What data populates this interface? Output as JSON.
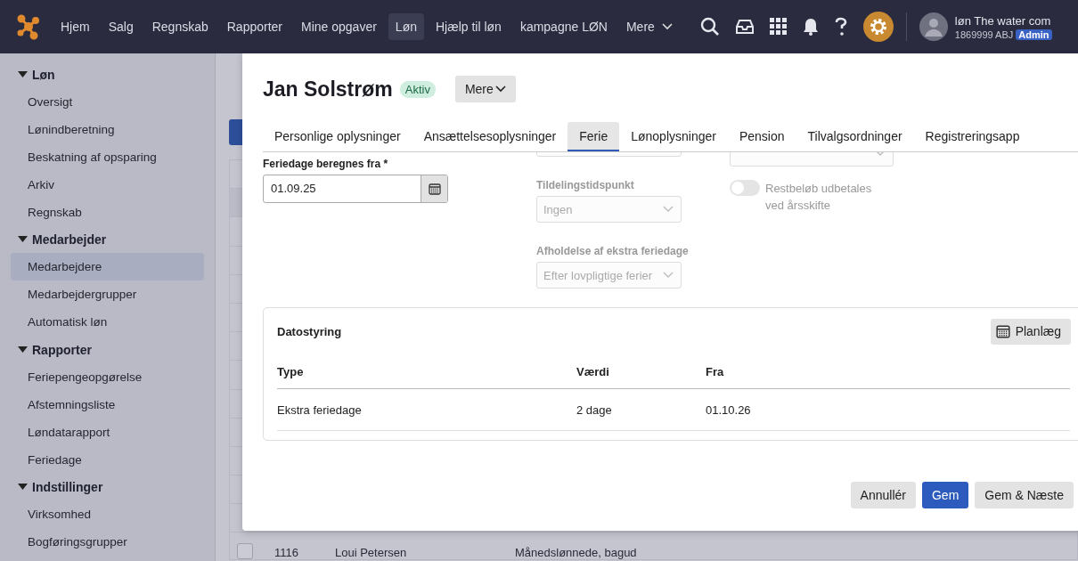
{
  "topbar": {
    "nav": [
      {
        "label": "Hjem",
        "selected": false
      },
      {
        "label": "Salg",
        "selected": false
      },
      {
        "label": "Regnskab",
        "selected": false
      },
      {
        "label": "Rapporter",
        "selected": false
      },
      {
        "label": "Mine opgaver",
        "selected": false
      },
      {
        "label": "Løn",
        "selected": true
      },
      {
        "label": "Hjælp til løn",
        "selected": false
      },
      {
        "label": "kampagne LØN",
        "selected": false
      }
    ],
    "more": "Mere",
    "user": {
      "name": "løn The water com",
      "account": "1869999 ABJ",
      "role": "Admin"
    }
  },
  "sidebar": {
    "groups": [
      {
        "title": "Løn",
        "expanded": true,
        "items": [
          {
            "label": "Oversigt",
            "selected": false
          },
          {
            "label": "Lønindberetning",
            "selected": false
          },
          {
            "label": "Beskatning af opsparing",
            "selected": false
          },
          {
            "label": "Arkiv",
            "selected": false
          },
          {
            "label": "Regnskab",
            "selected": false
          }
        ]
      },
      {
        "title": "Medarbejder",
        "expanded": true,
        "items": [
          {
            "label": "Medarbejdere",
            "selected": true
          },
          {
            "label": "Medarbejdergrupper",
            "selected": false
          },
          {
            "label": "Automatisk løn",
            "selected": false
          }
        ]
      },
      {
        "title": "Rapporter",
        "expanded": true,
        "items": [
          {
            "label": "Feriepengeopgørelse",
            "selected": false
          },
          {
            "label": "Afstemningsliste",
            "selected": false
          },
          {
            "label": "Løndatarapport",
            "selected": false
          },
          {
            "label": "Feriedage",
            "selected": false
          }
        ]
      },
      {
        "title": "Indstillinger",
        "expanded": true,
        "items": [
          {
            "label": "Virksomhed",
            "selected": false
          },
          {
            "label": "Bogføringsgrupper",
            "selected": false
          }
        ]
      }
    ]
  },
  "page": {
    "last_row": {
      "checked": false,
      "cells": [
        "1116",
        "Loui Petersen",
        "Månedslønnede, bagud"
      ]
    }
  },
  "modal": {
    "title": "Jan Solstrøm",
    "status": "Aktiv",
    "more": "Mere",
    "tabs": [
      {
        "label": "Personlige oplysninger",
        "selected": false
      },
      {
        "label": "Ansættelsesoplysninger",
        "selected": false
      },
      {
        "label": "Ferie",
        "selected": true
      },
      {
        "label": "Lønoplysninger",
        "selected": false
      },
      {
        "label": "Pension",
        "selected": false
      },
      {
        "label": "Tilvalgsordninger",
        "selected": false
      },
      {
        "label": "Registreringsapp",
        "selected": false
      }
    ],
    "columns": [
      [
        {
          "kind": "date",
          "label": "Feriedage beregnes fra *",
          "value": "01.09.25"
        }
      ],
      [
        {
          "kind": "select",
          "disabled": true
        },
        {
          "kind": "select",
          "label": "Tildelingstidspunkt",
          "value": "Ingen",
          "disabled": true
        },
        {
          "kind": "select",
          "label": "Afholdelse af ekstra feriedage",
          "value": "Efter lovpligtige ferier",
          "disabled": true
        }
      ],
      [
        {
          "kind": "select",
          "disabled": true
        },
        {
          "kind": "toggle",
          "label": "Restbeløb udbetales ved årsskifte",
          "on": false,
          "disabled": true
        }
      ]
    ],
    "schedule": {
      "title": "Datostyring",
      "button": "Planlæg",
      "columns": [
        "Type",
        "Værdi",
        "Fra"
      ],
      "rows": [
        [
          "Ekstra feriedage",
          "2 dage",
          "01.10.26"
        ]
      ]
    },
    "footer": [
      "Annullér",
      "Gem",
      "Gem & Næste"
    ]
  }
}
